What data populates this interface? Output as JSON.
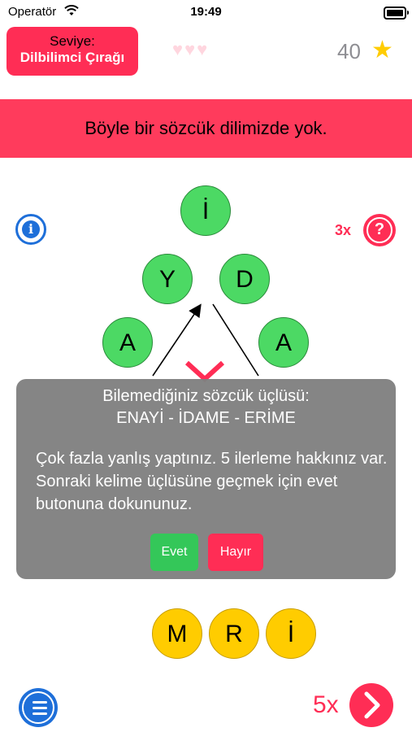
{
  "status_bar": {
    "carrier": "Operatör",
    "time": "19:49"
  },
  "level": {
    "title": "Seviye:",
    "name": "Dilbilimci Çırağı"
  },
  "lives": {
    "hearts": "♥♥♥"
  },
  "score": {
    "value": "40",
    "icon": "star-icon"
  },
  "banner": {
    "message": "Böyle bir sözcük dilimizde yok."
  },
  "hint": {
    "count": "3x",
    "help_symbol": "?",
    "info_symbol": "i"
  },
  "triangle": {
    "top": "İ",
    "left_edge": [
      "Y",
      "A"
    ],
    "right_edge": [
      "D",
      "A"
    ]
  },
  "dialog": {
    "title": "Bilemediğiniz sözcük üçlüsü:",
    "words": "ENAYİ - İDAME - ERİME",
    "message": "Çok fazla yanlış yaptınız. 5 ilerleme hakkınız var. Sonraki kelime üçlüsüne geçmek için evet butonuna dokununuz.",
    "yes_label": "Evet",
    "no_label": "Hayır"
  },
  "letter_pool": [
    "M",
    "R",
    "İ"
  ],
  "skip": {
    "count": "5x"
  },
  "colors": {
    "accent_red": "#ff2d55",
    "green": "#4cd964",
    "yellow": "#ffcc00",
    "blue": "#1e6fd9"
  }
}
